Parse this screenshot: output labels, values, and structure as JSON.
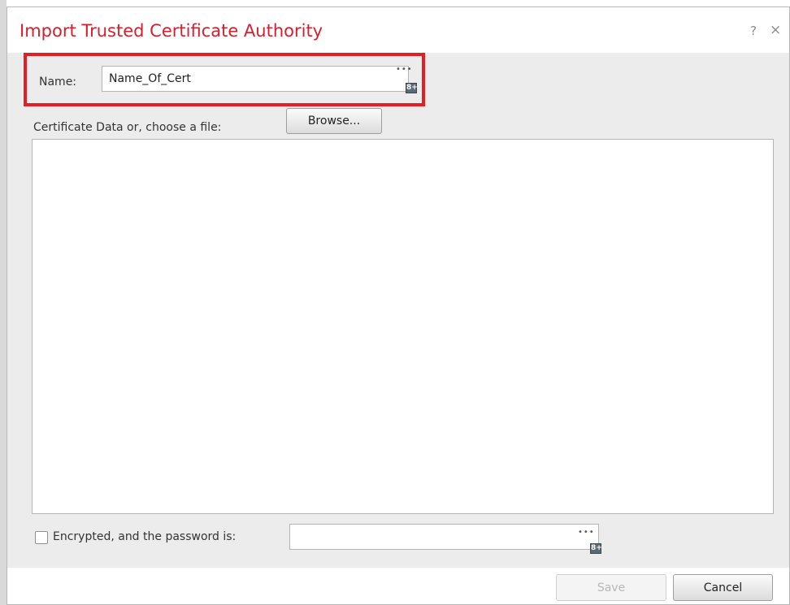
{
  "dialog": {
    "title": "Import Trusted Certificate Authority",
    "help_icon": "?",
    "close_icon": "×"
  },
  "name_field": {
    "label": "Name:",
    "value": "Name_Of_Cert",
    "dots_icon": "•••",
    "object_icon": "8+"
  },
  "certificate": {
    "label": "Certificate Data or, choose a file:",
    "browse_label": "Browse...",
    "data": ""
  },
  "encryption": {
    "label": "Encrypted, and the password is:",
    "checked": false,
    "password": "",
    "dots_icon": "•••",
    "object_icon": "8+"
  },
  "footer": {
    "save_label": "Save",
    "cancel_label": "Cancel"
  },
  "colors": {
    "title_red": "#d4202f",
    "highlight_red": "#e51e26",
    "dialog_bg": "#ececec"
  }
}
